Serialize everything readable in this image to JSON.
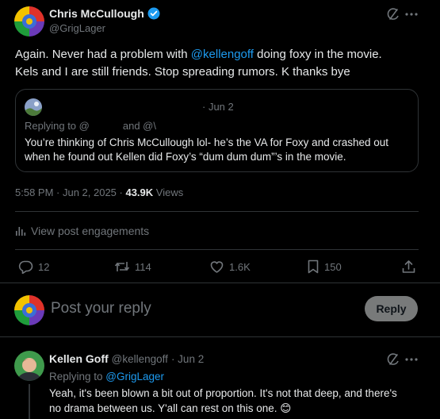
{
  "post": {
    "author_name": "Chris McCullough",
    "author_handle": "@GrigLager",
    "text_pre": "Again. Never had a problem with ",
    "mention": "@kellengoff",
    "text_post": " doing foxy in the movie.",
    "text_line2": "Kels and I are still friends.  Stop spreading rumors.  K thanks bye",
    "meta_time": "5:58 PM · Jun 2, 2025 · ",
    "meta_views_count": "43.9K",
    "meta_views_label": " Views",
    "engagements_label": "View post engagements"
  },
  "quote": {
    "date": "· Jun 2",
    "replying_prefix": "Replying to @",
    "replying_and": "and @\\",
    "text_line1": "You’re thinking of Chris McCullough lol- he’s the VA for Foxy and crashed out",
    "text_line2": "when he found out Kellen did Foxy’s “dum dum dum”’s in the movie."
  },
  "actions": {
    "replies": "12",
    "reposts": "114",
    "likes": "1.6K",
    "bookmarks": "150"
  },
  "composer": {
    "placeholder": "Post your reply",
    "reply_button": "Reply"
  },
  "reply": {
    "author_name": "Kellen Goff",
    "author_handle": "@kellengoff",
    "date": "· Jun 2",
    "replying_prefix": "Replying to ",
    "replying_handle": "@GrigLager",
    "text_line1": "Yeah, it's been blown a bit out of proportion. It's not that deep, and there's",
    "text_line2": "no drama between us. Y'all can rest on this one. 😊"
  },
  "colors": {
    "accent": "#1d9bf0",
    "verified": "#1d9bf0",
    "background": "#000000",
    "border": "#2f3336",
    "muted": "#71767b"
  }
}
